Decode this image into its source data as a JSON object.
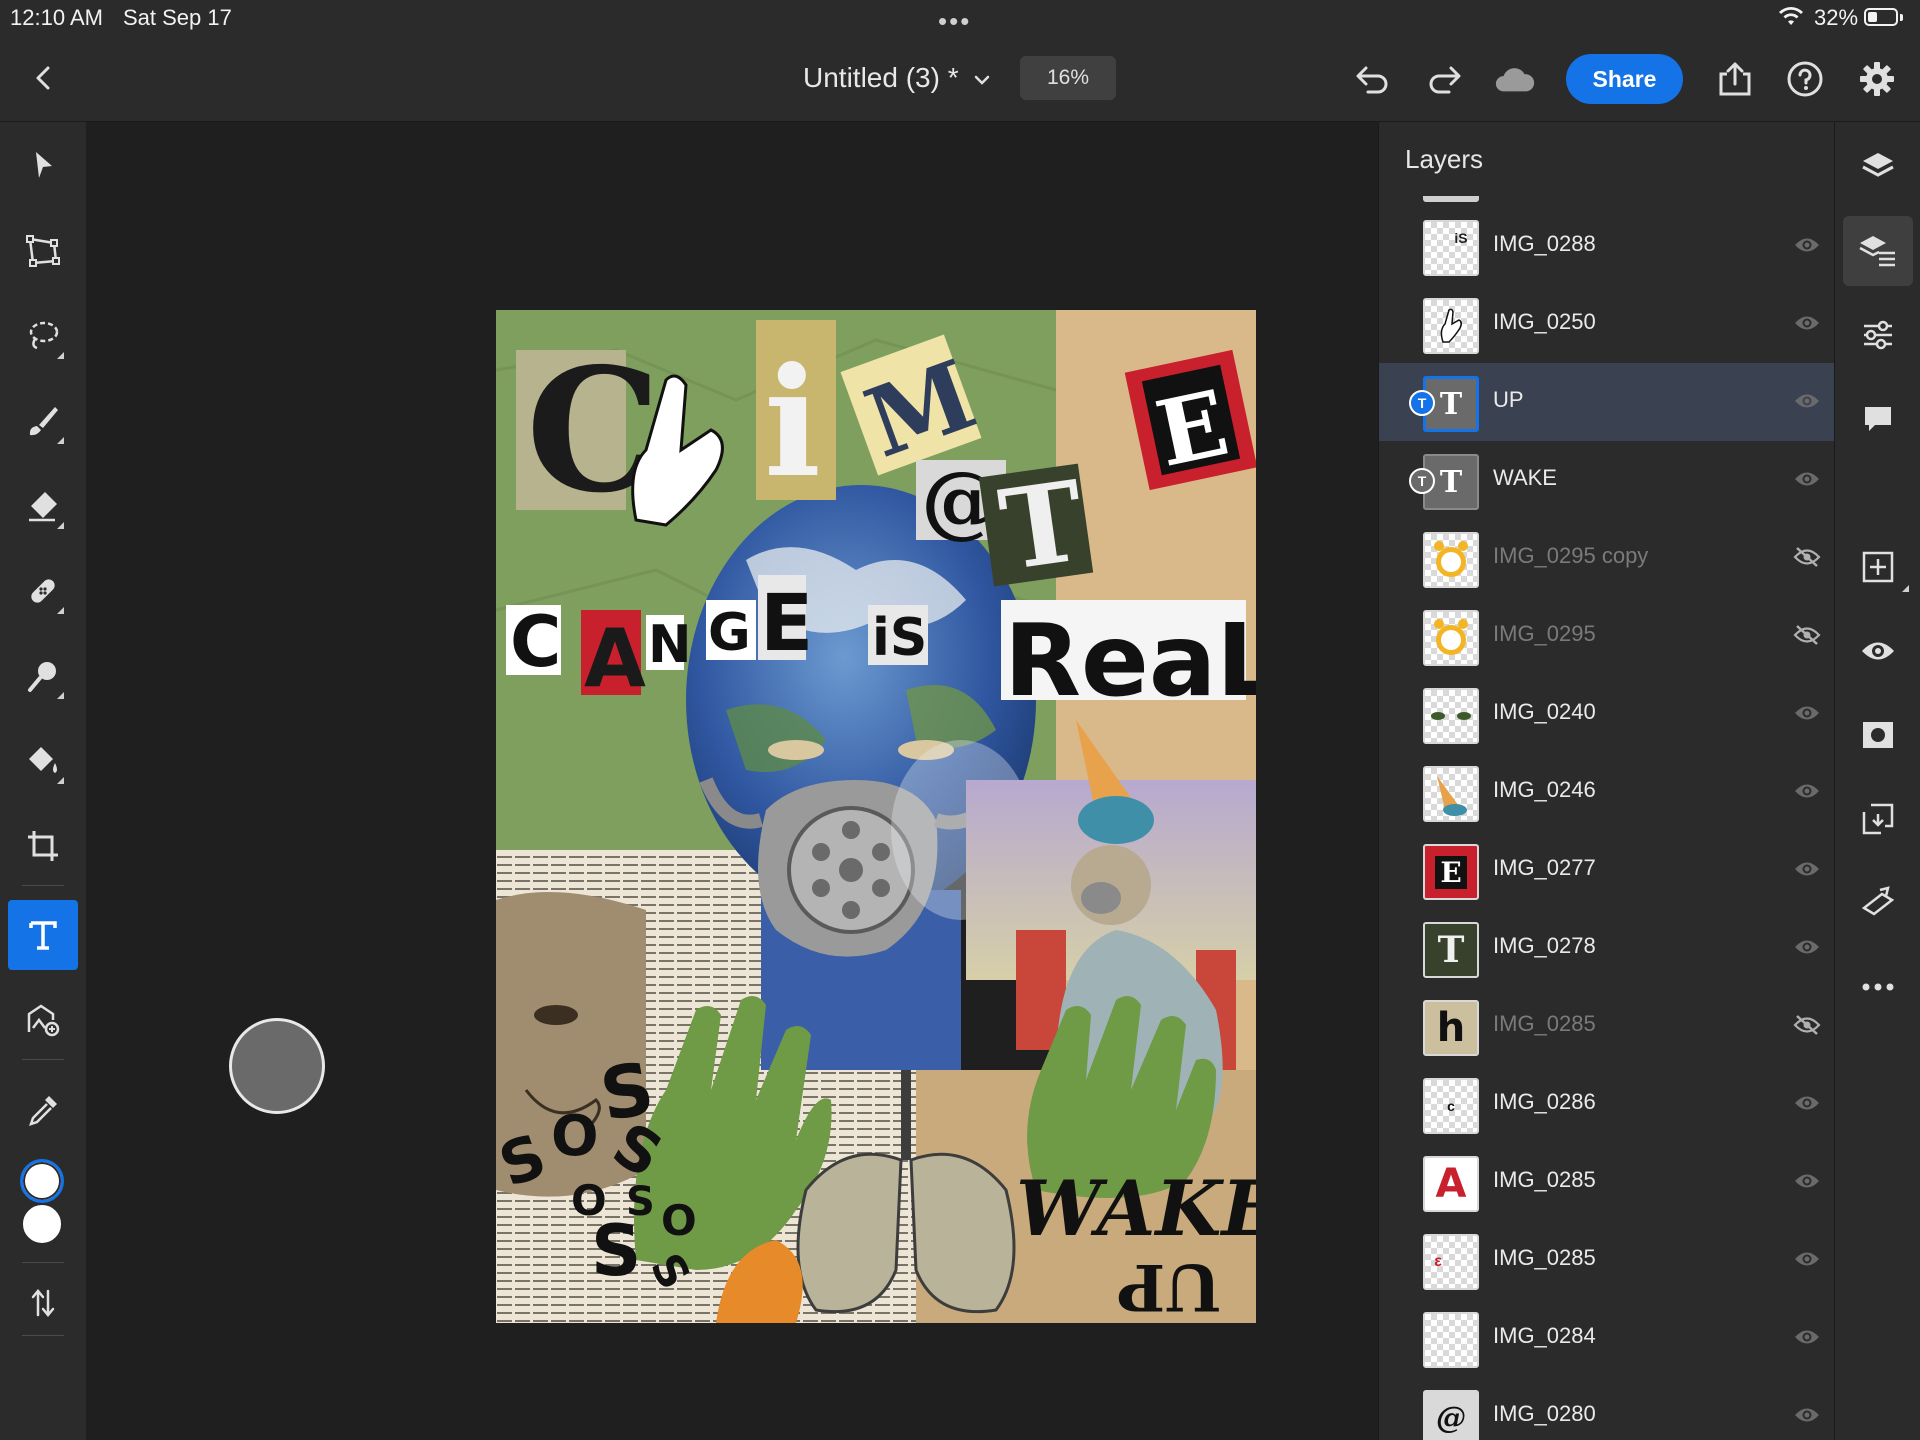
{
  "status_bar": {
    "time": "12:10 AM",
    "date": "Sat Sep 17",
    "battery": "32%"
  },
  "header": {
    "document_title": "Untitled (3) *",
    "zoom": "16%",
    "share_label": "Share"
  },
  "artwork_text": {
    "climate": [
      "C",
      "i",
      "M",
      "@",
      "T",
      "E"
    ],
    "cange": [
      "C",
      "A",
      "N",
      "G",
      "E"
    ],
    "is": "iS",
    "real": "ReaL",
    "wake": "WAKE",
    "up": "UP",
    "sos": [
      "S",
      "O",
      "S",
      "S",
      "O",
      "S",
      "S",
      "O",
      "S"
    ]
  },
  "layers_panel": {
    "title": "Layers",
    "layers": [
      {
        "name": "IMG_0288",
        "visible": true,
        "kind": "image",
        "thumb": "iS"
      },
      {
        "name": "IMG_0250",
        "visible": true,
        "kind": "image",
        "thumb": "hand"
      },
      {
        "name": "UP",
        "visible": true,
        "kind": "text",
        "thumb": "T",
        "selected": true
      },
      {
        "name": "WAKE",
        "visible": true,
        "kind": "text",
        "thumb": "T"
      },
      {
        "name": "IMG_0295 copy",
        "visible": false,
        "kind": "image",
        "thumb": "alarm-clock"
      },
      {
        "name": "IMG_0295",
        "visible": false,
        "kind": "image",
        "thumb": "alarm-clock"
      },
      {
        "name": "IMG_0240",
        "visible": true,
        "kind": "image",
        "thumb": "eyes"
      },
      {
        "name": "IMG_0246",
        "visible": true,
        "kind": "image",
        "thumb": "ice-cream"
      },
      {
        "name": "IMG_0277",
        "visible": true,
        "kind": "image",
        "thumb": "E"
      },
      {
        "name": "IMG_0278",
        "visible": true,
        "kind": "image",
        "thumb": "T"
      },
      {
        "name": "IMG_0285",
        "visible": false,
        "kind": "image",
        "thumb": "h"
      },
      {
        "name": "IMG_0286",
        "visible": true,
        "kind": "image",
        "thumb": "c"
      },
      {
        "name": "IMG_0285",
        "visible": true,
        "kind": "image",
        "thumb": "A"
      },
      {
        "name": "IMG_0285",
        "visible": true,
        "kind": "image",
        "thumb": "ε"
      },
      {
        "name": "IMG_0284",
        "visible": true,
        "kind": "image",
        "thumb": ""
      },
      {
        "name": "IMG_0280",
        "visible": true,
        "kind": "image",
        "thumb": "@"
      }
    ]
  },
  "colors": {
    "accent": "#1473e6",
    "panel": "#2b2b2b",
    "canvas_bg": "#1f1f1f",
    "selected_row": "#3a4150"
  }
}
